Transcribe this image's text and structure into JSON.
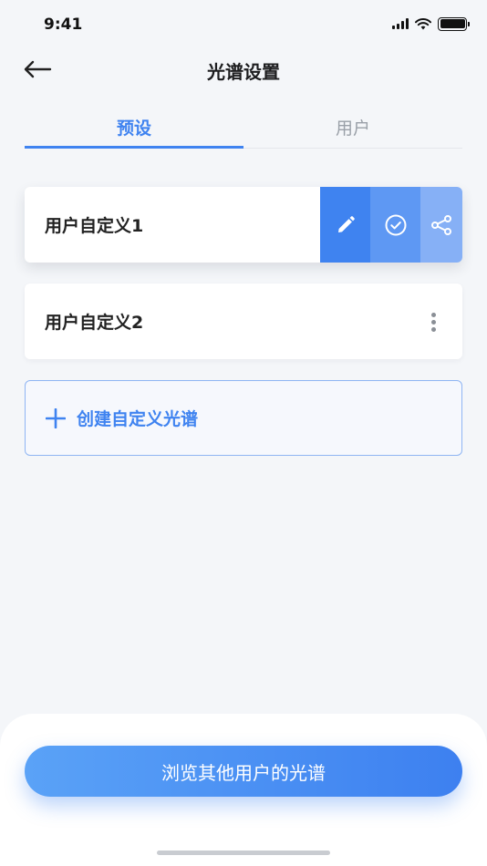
{
  "status_bar": {
    "time": "9:41"
  },
  "nav": {
    "title": "光谱设置"
  },
  "tabs": [
    {
      "label": "预设",
      "active": true
    },
    {
      "label": "用户",
      "active": false
    }
  ],
  "spectra": [
    {
      "label": "用户自定义1",
      "actions": [
        "pencil-icon",
        "check-circle-icon",
        "share-icon"
      ]
    },
    {
      "label": "用户自定义2",
      "actions": [
        "more-vertical-icon"
      ]
    }
  ],
  "create_button": {
    "label": "创建自定义光谱",
    "icon": "plus-icon"
  },
  "browse_button": {
    "label": "浏览其他用户的光谱"
  },
  "colors": {
    "accent": "#3f83f0",
    "action_check": "#5e98f3",
    "action_share": "#86b0f6",
    "background": "#f4f6f9"
  }
}
